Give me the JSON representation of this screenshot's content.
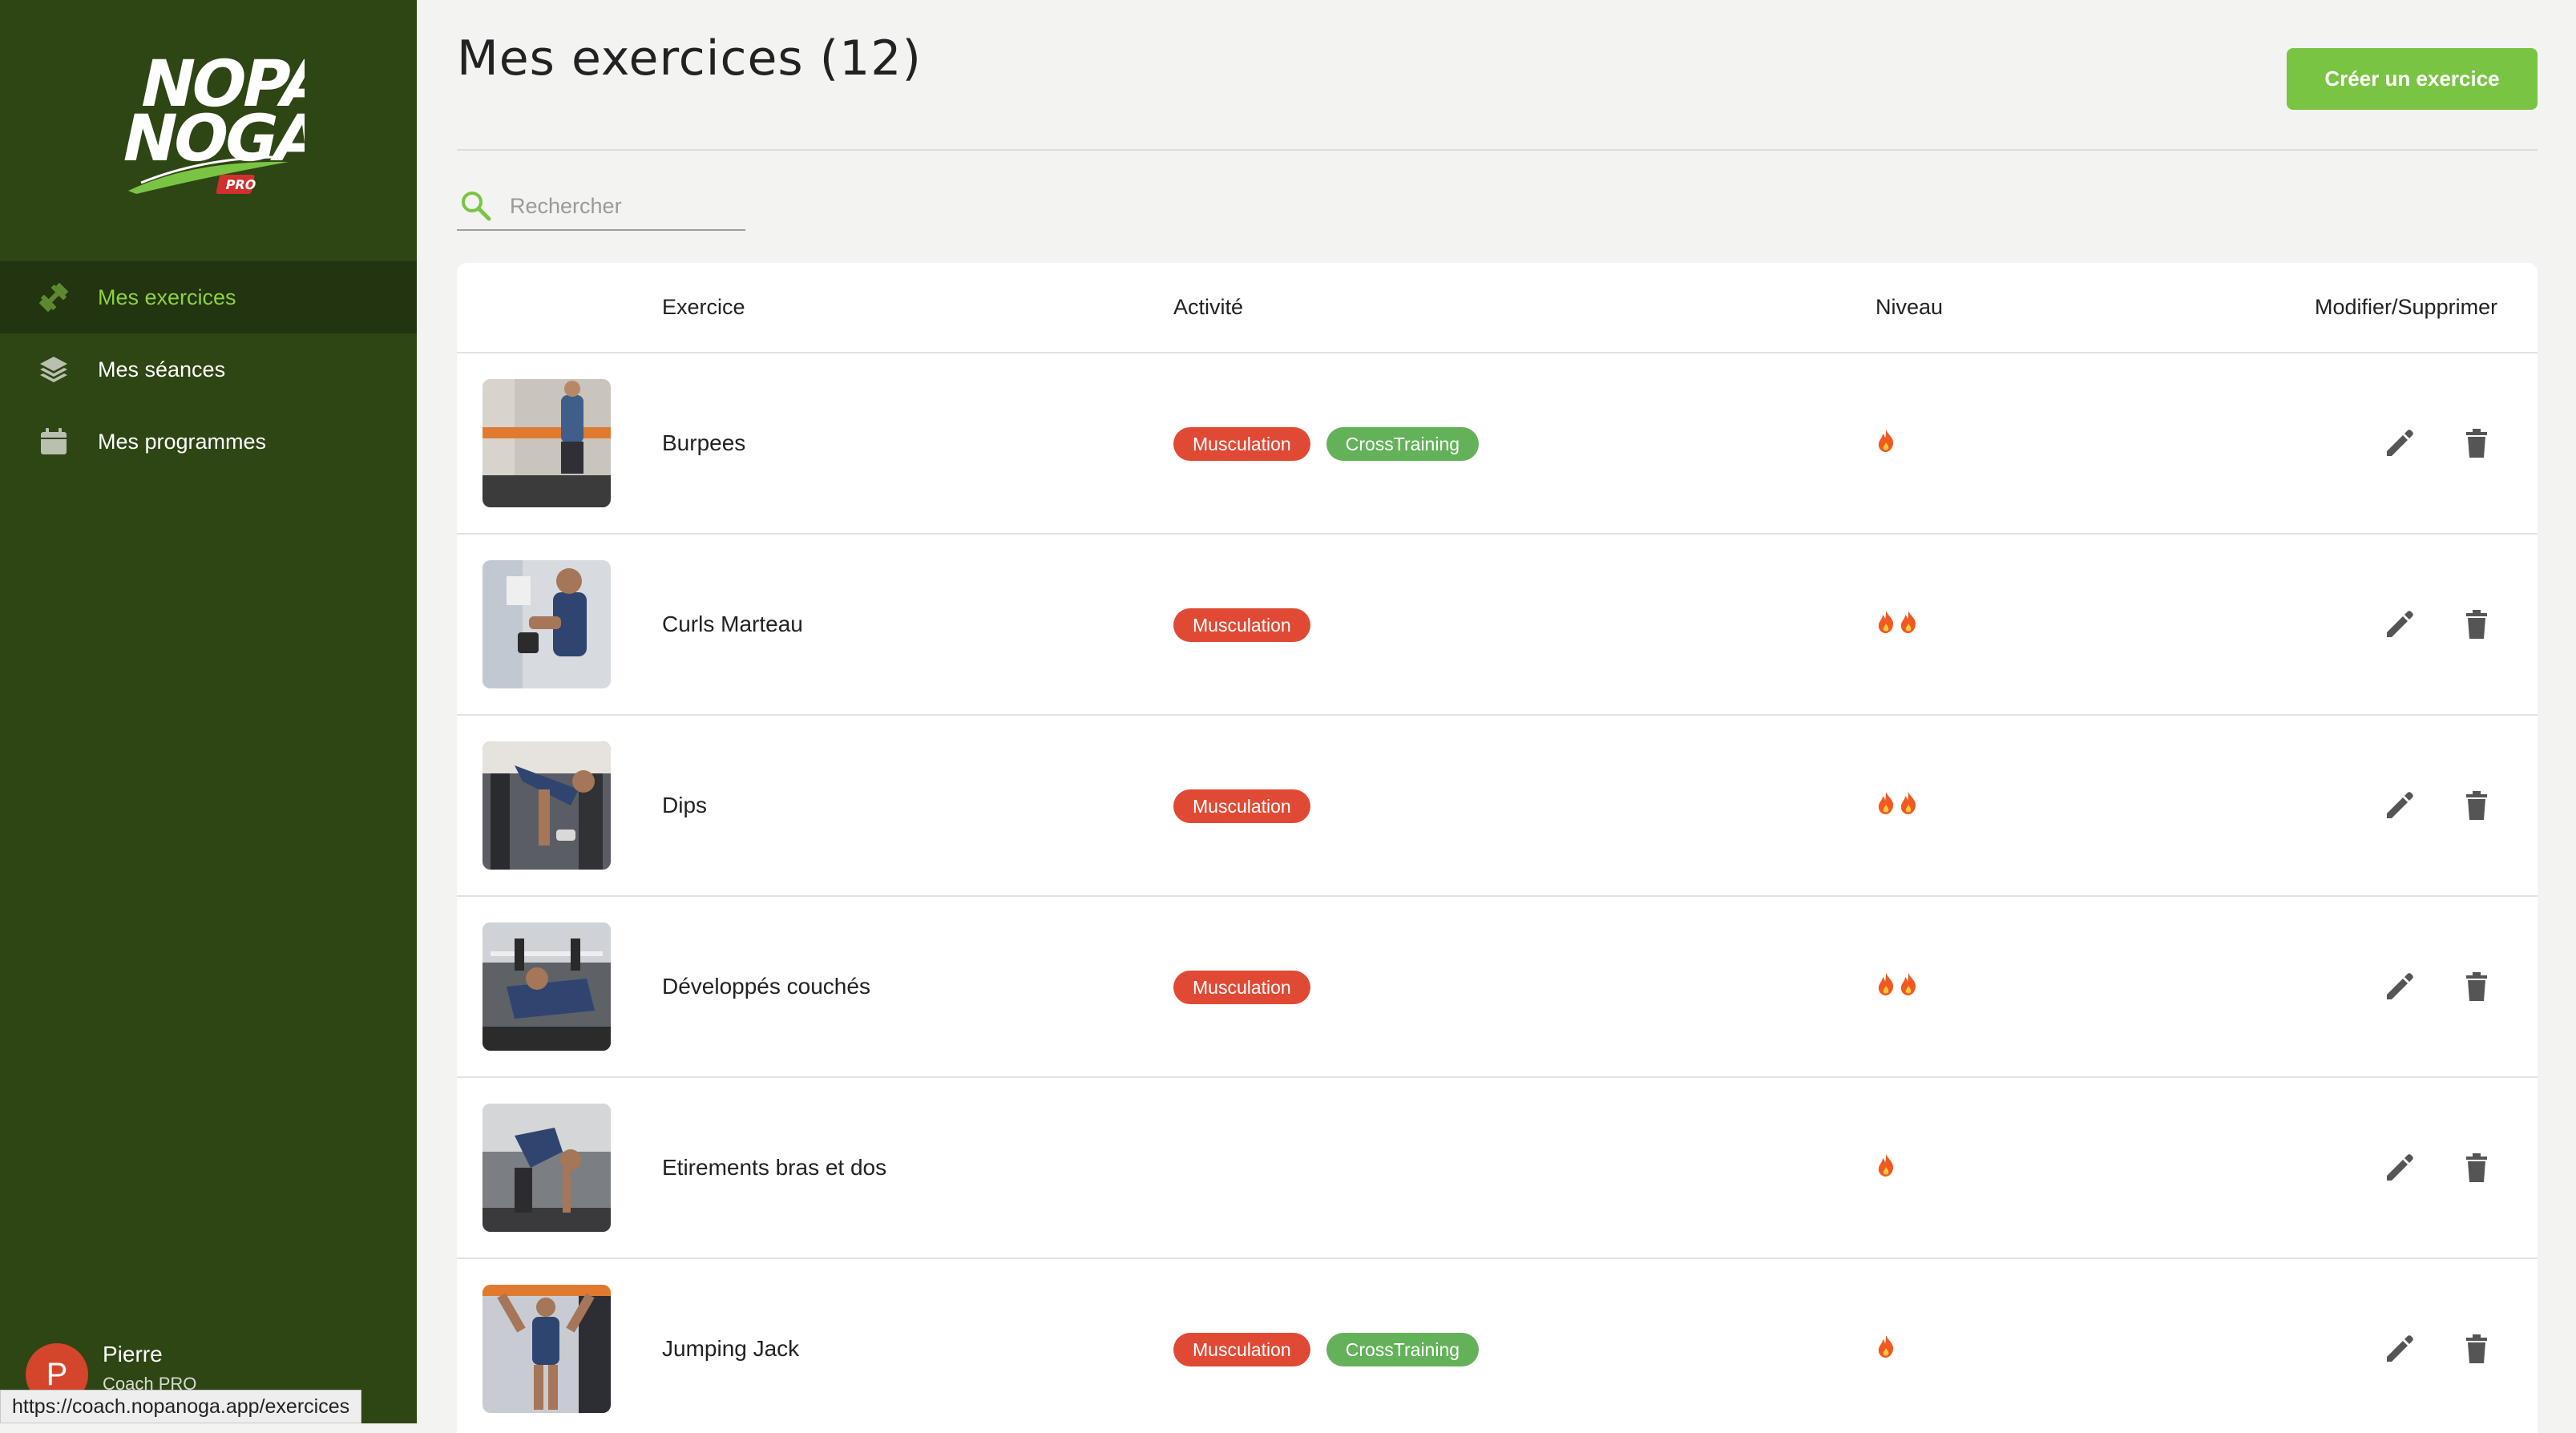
{
  "app": {
    "logo_text": "NOPANOGA",
    "logo_badge": "PRO"
  },
  "sidebar": {
    "items": [
      {
        "label": "Mes exercices",
        "icon": "dumbbell-icon",
        "active": true
      },
      {
        "label": "Mes séances",
        "icon": "layers-icon",
        "active": false
      },
      {
        "label": "Mes programmes",
        "icon": "calendar-icon",
        "active": false
      }
    ],
    "user": {
      "initial": "P",
      "name": "Pierre",
      "role": "Coach PRO"
    }
  },
  "status_url": "https://coach.nopanoga.app/exercices",
  "header": {
    "title": "Mes exercices (12)",
    "create_button": "Créer un exercice"
  },
  "search": {
    "placeholder": "Rechercher",
    "value": ""
  },
  "table": {
    "columns": [
      "Exercice",
      "Activité",
      "Niveau",
      "Modifier/Supprimer"
    ],
    "rows": [
      {
        "name": "Burpees",
        "tags": [
          "Musculation",
          "CrossTraining"
        ],
        "level": 1
      },
      {
        "name": "Curls Marteau",
        "tags": [
          "Musculation"
        ],
        "level": 2
      },
      {
        "name": "Dips",
        "tags": [
          "Musculation"
        ],
        "level": 2
      },
      {
        "name": "Développés couchés",
        "tags": [
          "Musculation"
        ],
        "level": 2
      },
      {
        "name": "Etirements bras et dos",
        "tags": [],
        "level": 1
      },
      {
        "name": "Jumping Jack",
        "tags": [
          "Musculation",
          "CrossTraining"
        ],
        "level": 1
      }
    ]
  },
  "colors": {
    "sidebar_bg": "#2e4514",
    "accent_green": "#7ac443",
    "tag_musculation": "#e04a35",
    "tag_crosstraining": "#63b25a",
    "flame": "#f05a22"
  }
}
